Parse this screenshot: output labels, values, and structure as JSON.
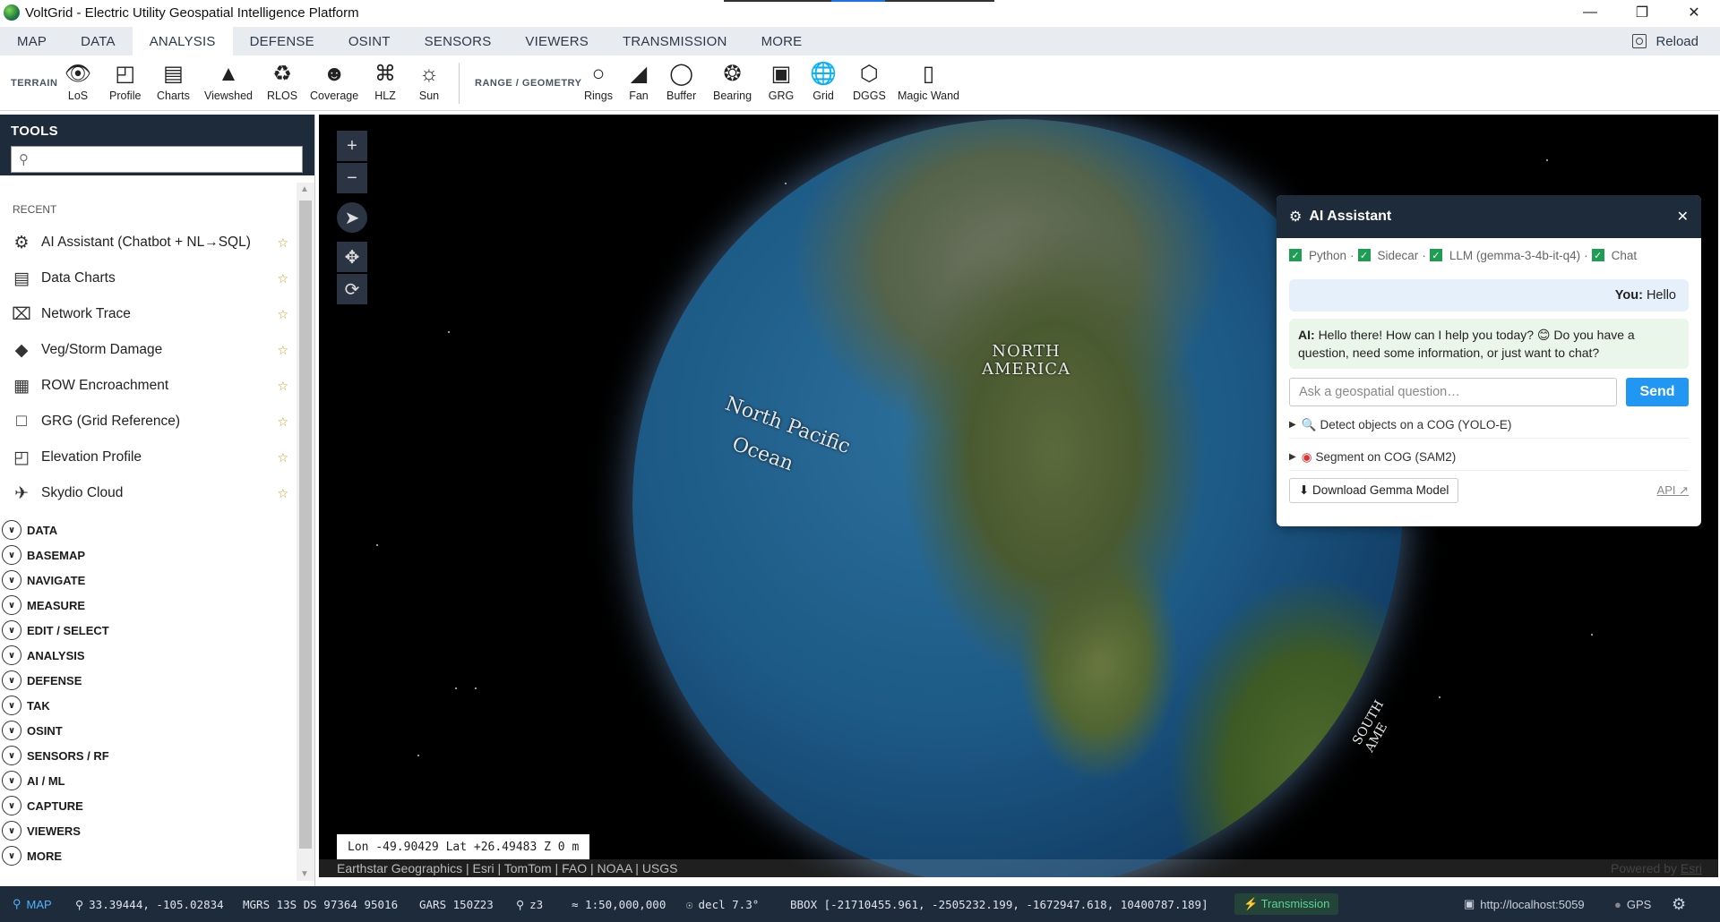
{
  "window": {
    "title": "VoltGrid - Electric Utility Geospatial Intelligence Platform",
    "controls": [
      "minimize-icon",
      "maximize-icon",
      "close-icon"
    ]
  },
  "menubar": {
    "tabs": [
      "MAP",
      "DATA",
      "ANALYSIS",
      "DEFENSE",
      "OSINT",
      "SENSORS",
      "VIEWERS",
      "TRANSMISSION",
      "MORE"
    ],
    "active": "ANALYSIS",
    "reload_label": "Reload"
  },
  "ribbon": {
    "terrain_label": "TERRAIN",
    "terrain_tools": [
      {
        "label": "LoS",
        "icon": "eye-icon"
      },
      {
        "label": "Profile",
        "icon": "profile-icon"
      },
      {
        "label": "Charts",
        "icon": "bar-chart-icon"
      },
      {
        "label": "Viewshed",
        "icon": "mountain-icon"
      },
      {
        "label": "RLOS",
        "icon": "tower-icon"
      },
      {
        "label": "Coverage",
        "icon": "people-icon"
      },
      {
        "label": "HLZ",
        "icon": "helipad-icon"
      },
      {
        "label": "Sun",
        "icon": "sun-icon"
      }
    ],
    "range_label": "RANGE / GEOMETRY",
    "range_tools": [
      {
        "label": "Rings",
        "icon": "ring-icon"
      },
      {
        "label": "Fan",
        "icon": "fan-icon"
      },
      {
        "label": "Buffer",
        "icon": "buffer-icon"
      },
      {
        "label": "Bearing",
        "icon": "compass-icon"
      },
      {
        "label": "GRG",
        "icon": "grg-square-icon"
      },
      {
        "label": "Grid",
        "icon": "globe-grid-icon"
      },
      {
        "label": "DGGS",
        "icon": "hexagon-icon"
      },
      {
        "label": "Magic Wand",
        "icon": "wand-icon"
      }
    ]
  },
  "sidebar": {
    "title": "TOOLS",
    "search_placeholder": "",
    "recent_label": "RECENT",
    "recent": [
      {
        "label": "AI Assistant (Chatbot + NL→SQL)",
        "icon": "robot-icon"
      },
      {
        "label": "Data Charts",
        "icon": "bar-chart-icon"
      },
      {
        "label": "Network Trace",
        "icon": "network-trace-icon"
      },
      {
        "label": "Veg/Storm Damage",
        "icon": "tree-icon"
      },
      {
        "label": "ROW Encroachment",
        "icon": "hatch-icon"
      },
      {
        "label": "GRG (Grid Reference)",
        "icon": "grg-square-icon"
      },
      {
        "label": "Elevation Profile",
        "icon": "profile-icon"
      },
      {
        "label": "Skydio Cloud",
        "icon": "drone-icon"
      }
    ],
    "sections": [
      "DATA",
      "BASEMAP",
      "NAVIGATE",
      "MEASURE",
      "EDIT / SELECT",
      "ANALYSIS",
      "DEFENSE",
      "TAK",
      "OSINT",
      "SENSORS / RF",
      "AI / ML",
      "CAPTURE",
      "VIEWERS",
      "MORE"
    ]
  },
  "map": {
    "labels": {
      "continent": "NORTH\nAMERICA",
      "ocean_line1": "North Pacific",
      "ocean_line2": "Ocean",
      "south": "SOUTH AME"
    },
    "coords_readout": "Lon -49.90429  Lat +26.49483  Z 0 m",
    "attribution": "Earthstar Geographics | Esri | TomTom | FAO | NOAA | USGS",
    "powered_prefix": "Powered by ",
    "powered_link": "Esri"
  },
  "ai_assistant": {
    "title": "AI Assistant",
    "status": [
      {
        "label": "Python",
        "ok": true
      },
      {
        "label": "Sidecar",
        "ok": true
      },
      {
        "label": "LLM (gemma-3-4b-it-q4)",
        "ok": true
      },
      {
        "label": "Chat",
        "ok": true
      }
    ],
    "user_prefix": "You:",
    "user_message": "Hello",
    "ai_prefix": "AI:",
    "ai_message": "Hello there! How can I help you today? 😊 Do you have a question, need some information, or just want to chat?",
    "input_placeholder": "Ask a geospatial question…",
    "send_label": "Send",
    "actions": [
      {
        "label": "Detect objects on a COG (YOLO-E)",
        "icon": "magnifier-icon"
      },
      {
        "label": "Segment on COG (SAM2)",
        "icon": "target-icon"
      }
    ],
    "download_label": "⬇ Download Gemma Model",
    "api_label": "API ↗"
  },
  "statusbar": {
    "map_chip": "MAP",
    "latlon": "33.39444, -105.02834",
    "mgrs": "MGRS 13S DS 97364 95016",
    "gars": "GARS 150Z23",
    "zoom": "z3",
    "scale": "≈ 1:50,000,000",
    "decl": "decl 7.3°",
    "bbox": "BBOX [-21710455.961, -2505232.199, -1672947.618, 10400787.189]",
    "transmission": "Transmission",
    "server": "http://localhost:5059",
    "gps": "GPS"
  }
}
